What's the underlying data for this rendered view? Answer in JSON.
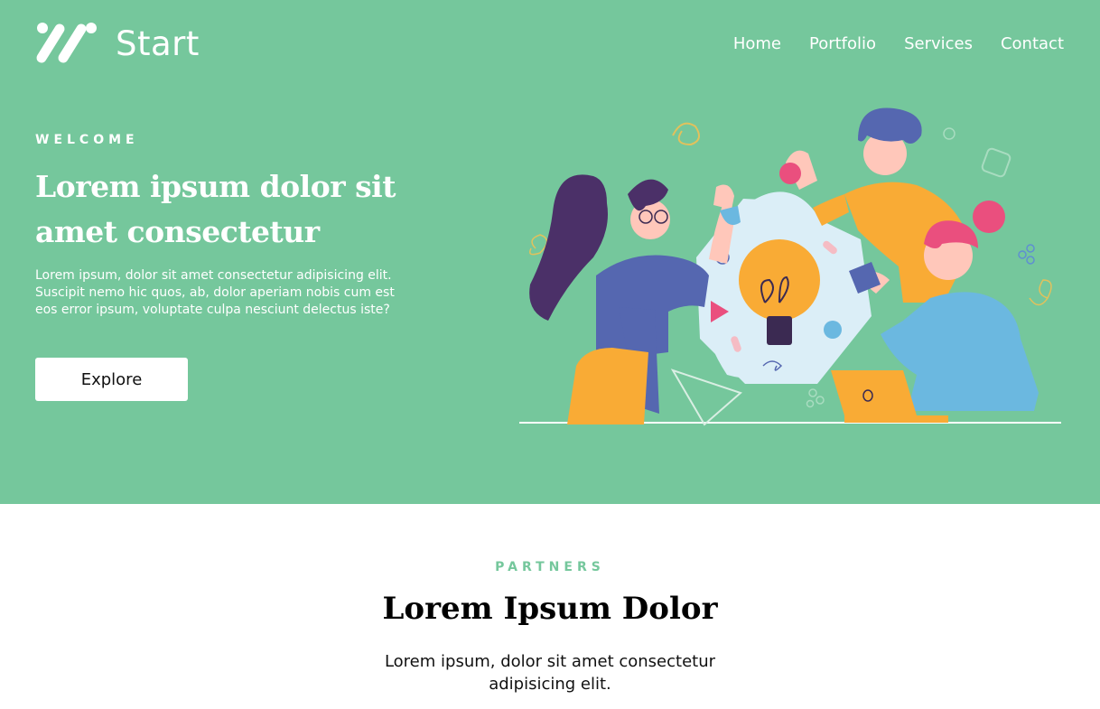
{
  "brand": {
    "name": "Start",
    "icon": "logo-slashes-icon"
  },
  "nav": {
    "items": [
      {
        "label": "Home"
      },
      {
        "label": "Portfolio"
      },
      {
        "label": "Services"
      },
      {
        "label": "Contact"
      }
    ]
  },
  "hero": {
    "kicker": "WELCOME",
    "title": "Lorem ipsum dolor sit amet consectetur",
    "text": "Lorem ipsum, dolor sit amet consectetur adipisicing elit. Suscipit nemo hic quos, ab, dolor aperiam nobis cum est eos error ipsum, voluptate culpa nesciunt delectus iste?",
    "button": "Explore",
    "illustration": "team-ideas-illustration"
  },
  "partners": {
    "kicker": "PARTNERS",
    "title": "Lorem Ipsum Dolor",
    "text": "Lorem ipsum, dolor sit amet consectetur adipisicing elit."
  },
  "colors": {
    "hero_bg": "#75c79c",
    "accent": "#75c79c",
    "yellow": "#f9ab35",
    "blue": "#5567b0",
    "pink": "#ea4f7e",
    "light_blue": "#6bb8e0"
  }
}
